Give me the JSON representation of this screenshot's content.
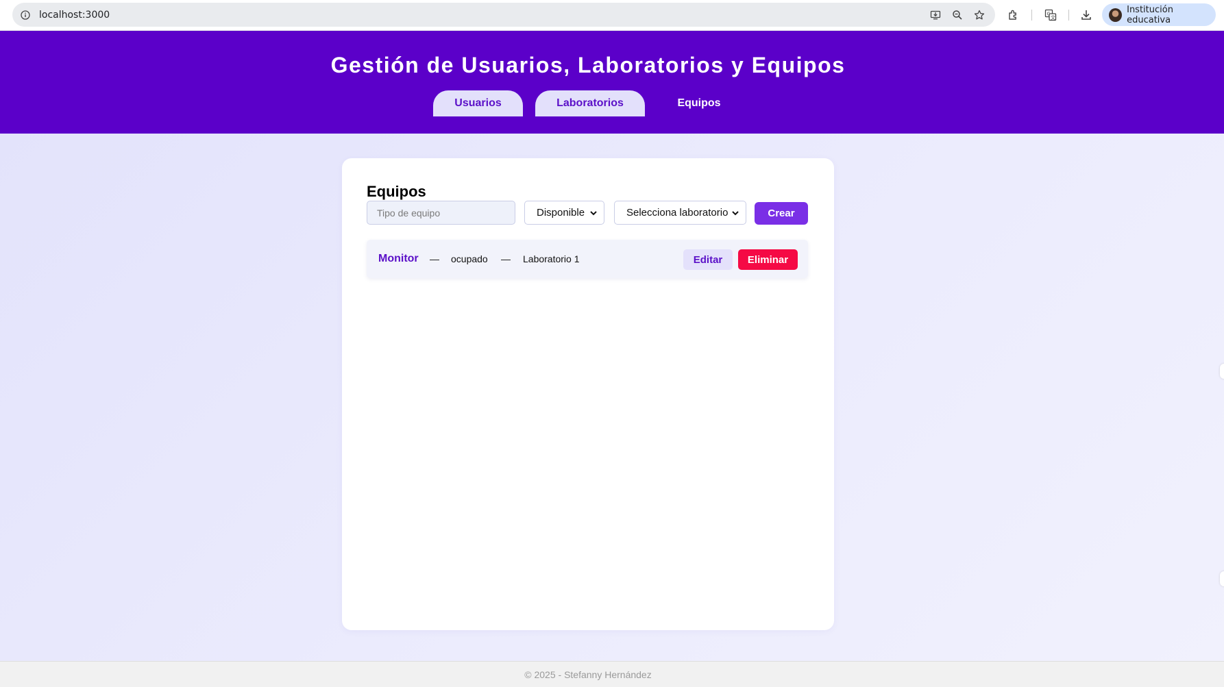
{
  "browser": {
    "url": "localhost:3000",
    "profile_name": "Institución educativa",
    "icons": [
      "info-icon",
      "install-app-icon",
      "zoom-icon",
      "bookmark-star-icon",
      "extensions-icon",
      "translate-icon",
      "download-icon"
    ]
  },
  "header": {
    "title": "Gestión de Usuarios, Laboratorios y Equipos",
    "tabs": [
      {
        "label": "Usuarios",
        "active": false
      },
      {
        "label": "Laboratorios",
        "active": false
      },
      {
        "label": "Equipos",
        "active": true
      }
    ],
    "bg_color": "#5b00c9"
  },
  "equipos": {
    "heading": "Equipos",
    "form": {
      "tipo_placeholder": "Tipo de equipo",
      "tipo_value": "",
      "estado_selected": "Disponible",
      "laboratorio_selected": "Selecciona laboratorio",
      "create_label": "Crear"
    },
    "items": [
      {
        "name": "Monitor",
        "separator": "—",
        "status": "ocupado",
        "lab": "Laboratorio 1",
        "edit_label": "Editar",
        "delete_label": "Eliminar"
      }
    ]
  },
  "footer": {
    "text": "© 2025 - Stefanny Hernández"
  },
  "colors": {
    "accent": "#7a2fe6",
    "danger": "#f50a45",
    "tab_pill": "#e3e0fb"
  }
}
